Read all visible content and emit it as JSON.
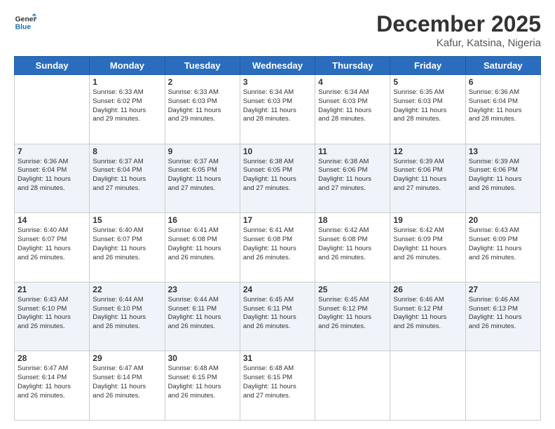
{
  "logo": {
    "line1": "General",
    "line2": "Blue"
  },
  "title": "December 2025",
  "location": "Kafur, Katsina, Nigeria",
  "days_header": [
    "Sunday",
    "Monday",
    "Tuesday",
    "Wednesday",
    "Thursday",
    "Friday",
    "Saturday"
  ],
  "weeks": [
    [
      {
        "day": "",
        "info": ""
      },
      {
        "day": "1",
        "info": "Sunrise: 6:33 AM\nSunset: 6:02 PM\nDaylight: 11 hours\nand 29 minutes."
      },
      {
        "day": "2",
        "info": "Sunrise: 6:33 AM\nSunset: 6:03 PM\nDaylight: 11 hours\nand 29 minutes."
      },
      {
        "day": "3",
        "info": "Sunrise: 6:34 AM\nSunset: 6:03 PM\nDaylight: 11 hours\nand 28 minutes."
      },
      {
        "day": "4",
        "info": "Sunrise: 6:34 AM\nSunset: 6:03 PM\nDaylight: 11 hours\nand 28 minutes."
      },
      {
        "day": "5",
        "info": "Sunrise: 6:35 AM\nSunset: 6:03 PM\nDaylight: 11 hours\nand 28 minutes."
      },
      {
        "day": "6",
        "info": "Sunrise: 6:36 AM\nSunset: 6:04 PM\nDaylight: 11 hours\nand 28 minutes."
      }
    ],
    [
      {
        "day": "7",
        "info": "Sunrise: 6:36 AM\nSunset: 6:04 PM\nDaylight: 11 hours\nand 28 minutes."
      },
      {
        "day": "8",
        "info": "Sunrise: 6:37 AM\nSunset: 6:04 PM\nDaylight: 11 hours\nand 27 minutes."
      },
      {
        "day": "9",
        "info": "Sunrise: 6:37 AM\nSunset: 6:05 PM\nDaylight: 11 hours\nand 27 minutes."
      },
      {
        "day": "10",
        "info": "Sunrise: 6:38 AM\nSunset: 6:05 PM\nDaylight: 11 hours\nand 27 minutes."
      },
      {
        "day": "11",
        "info": "Sunrise: 6:38 AM\nSunset: 6:06 PM\nDaylight: 11 hours\nand 27 minutes."
      },
      {
        "day": "12",
        "info": "Sunrise: 6:39 AM\nSunset: 6:06 PM\nDaylight: 11 hours\nand 27 minutes."
      },
      {
        "day": "13",
        "info": "Sunrise: 6:39 AM\nSunset: 6:06 PM\nDaylight: 11 hours\nand 26 minutes."
      }
    ],
    [
      {
        "day": "14",
        "info": "Sunrise: 6:40 AM\nSunset: 6:07 PM\nDaylight: 11 hours\nand 26 minutes."
      },
      {
        "day": "15",
        "info": "Sunrise: 6:40 AM\nSunset: 6:07 PM\nDaylight: 11 hours\nand 26 minutes."
      },
      {
        "day": "16",
        "info": "Sunrise: 6:41 AM\nSunset: 6:08 PM\nDaylight: 11 hours\nand 26 minutes."
      },
      {
        "day": "17",
        "info": "Sunrise: 6:41 AM\nSunset: 6:08 PM\nDaylight: 11 hours\nand 26 minutes."
      },
      {
        "day": "18",
        "info": "Sunrise: 6:42 AM\nSunset: 6:08 PM\nDaylight: 11 hours\nand 26 minutes."
      },
      {
        "day": "19",
        "info": "Sunrise: 6:42 AM\nSunset: 6:09 PM\nDaylight: 11 hours\nand 26 minutes."
      },
      {
        "day": "20",
        "info": "Sunrise: 6:43 AM\nSunset: 6:09 PM\nDaylight: 11 hours\nand 26 minutes."
      }
    ],
    [
      {
        "day": "21",
        "info": "Sunrise: 6:43 AM\nSunset: 6:10 PM\nDaylight: 11 hours\nand 26 minutes."
      },
      {
        "day": "22",
        "info": "Sunrise: 6:44 AM\nSunset: 6:10 PM\nDaylight: 11 hours\nand 26 minutes."
      },
      {
        "day": "23",
        "info": "Sunrise: 6:44 AM\nSunset: 6:11 PM\nDaylight: 11 hours\nand 26 minutes."
      },
      {
        "day": "24",
        "info": "Sunrise: 6:45 AM\nSunset: 6:11 PM\nDaylight: 11 hours\nand 26 minutes."
      },
      {
        "day": "25",
        "info": "Sunrise: 6:45 AM\nSunset: 6:12 PM\nDaylight: 11 hours\nand 26 minutes."
      },
      {
        "day": "26",
        "info": "Sunrise: 6:46 AM\nSunset: 6:12 PM\nDaylight: 11 hours\nand 26 minutes."
      },
      {
        "day": "27",
        "info": "Sunrise: 6:46 AM\nSunset: 6:13 PM\nDaylight: 11 hours\nand 26 minutes."
      }
    ],
    [
      {
        "day": "28",
        "info": "Sunrise: 6:47 AM\nSunset: 6:14 PM\nDaylight: 11 hours\nand 26 minutes."
      },
      {
        "day": "29",
        "info": "Sunrise: 6:47 AM\nSunset: 6:14 PM\nDaylight: 11 hours\nand 26 minutes."
      },
      {
        "day": "30",
        "info": "Sunrise: 6:48 AM\nSunset: 6:15 PM\nDaylight: 11 hours\nand 26 minutes."
      },
      {
        "day": "31",
        "info": "Sunrise: 6:48 AM\nSunset: 6:15 PM\nDaylight: 11 hours\nand 27 minutes."
      },
      {
        "day": "",
        "info": ""
      },
      {
        "day": "",
        "info": ""
      },
      {
        "day": "",
        "info": ""
      }
    ]
  ]
}
